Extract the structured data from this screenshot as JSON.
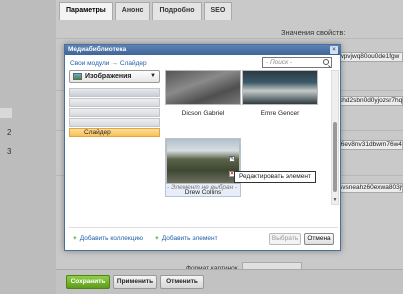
{
  "page": {
    "tabs": [
      "Параметры",
      "Анонс",
      "Подробно",
      "SEO"
    ],
    "properties_label": "Значения свойств:",
    "fields": [
      "wpvjwq80ou0de1fgw",
      "khd2sbn0d0yjozsr7hq5",
      "f6ev8nv31dbwm76w4g",
      "svsneahz60exwa803jv"
    ],
    "format_label": "Формат картинок",
    "left_numbers": [
      "2",
      "3"
    ],
    "buttons": {
      "save": "Сохранить",
      "apply": "Применить",
      "cancel": "Отменить"
    }
  },
  "modal": {
    "title": "Медиабиблиотека",
    "close": "×",
    "breadcrumb": [
      "Свои модули",
      "Слайдер"
    ],
    "search_placeholder": "- Поиск -",
    "type_select": "Изображения",
    "tree_active": "Слайдер",
    "items": [
      {
        "caption": "Dicson Gabriel",
        "icon": "rocks-photo"
      },
      {
        "caption": "Emre Gencer",
        "icon": "river-photo"
      },
      {
        "caption": "Drew Collins",
        "icon": "valley-photo"
      }
    ],
    "tooltip": "Редактировать элемент",
    "not_selected": "- Элемент не выбран -",
    "add_collection": "Добавить коллекцию",
    "add_element": "Добавить элемент",
    "choose": "Выбрать",
    "cancel": "Отмена"
  }
}
